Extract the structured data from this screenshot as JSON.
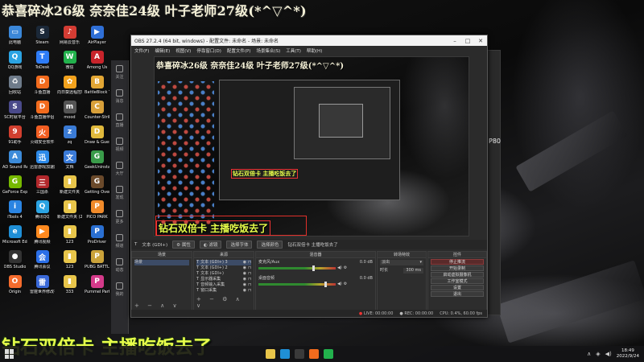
{
  "overlay": {
    "top_banner": "恭喜碎冰26级 奈奈佳24级 叶子老师27级(*^▽^*)",
    "bottom_banner": "钻石双倍卡 主播吃饭去了"
  },
  "desktop_icons": [
    {
      "label": "此电脑",
      "color": "#3b87d8",
      "glyph": "▭"
    },
    {
      "label": "Steam",
      "color": "#1b2838",
      "glyph": "S"
    },
    {
      "label": "网易云音乐",
      "color": "#d43c33",
      "glyph": "♪"
    },
    {
      "label": "AirPlayer",
      "color": "#2f6fd6",
      "glyph": "▶"
    },
    {
      "label": "QQ游戏",
      "color": "#2ba3e2",
      "glyph": "Q"
    },
    {
      "label": "ToDesk",
      "color": "#2e7cf6",
      "glyph": "T"
    },
    {
      "label": "微信",
      "color": "#22b14c",
      "glyph": "W"
    },
    {
      "label": "Among Us",
      "color": "#c8242b",
      "glyph": "A"
    },
    {
      "label": "回收站",
      "color": "#6e7b8a",
      "glyph": "♻"
    },
    {
      "label": "斗鱼直播",
      "color": "#f26b1d",
      "glyph": "D"
    },
    {
      "label": "向日葵远程控制",
      "color": "#f2a21d",
      "glyph": "✿"
    },
    {
      "label": "BattleBlock Theater",
      "color": "#e2a634",
      "glyph": "B"
    },
    {
      "label": "SC时就平台",
      "color": "#4a4a8a",
      "glyph": "S"
    },
    {
      "label": "斗鱼直播伴侣",
      "color": "#f26b1d",
      "glyph": "D"
    },
    {
      "label": "mood",
      "color": "#555555",
      "glyph": "m"
    },
    {
      "label": "Counter-Strike Global Off...",
      "color": "#d8a03a",
      "glyph": "C"
    },
    {
      "label": "91助手",
      "color": "#d13f2f",
      "glyph": "9"
    },
    {
      "label": "火绒安全软件",
      "color": "#f25e22",
      "glyph": "火"
    },
    {
      "label": "zq",
      "color": "#3a7bd5",
      "glyph": "z"
    },
    {
      "label": "Draw & Guess",
      "color": "#e0b93c",
      "glyph": "D"
    },
    {
      "label": "AD Sound Recorder",
      "color": "#3c8bd9",
      "glyph": "A"
    },
    {
      "label": "迅雷游戏加速器",
      "color": "#2d8ae8",
      "glyph": "迅"
    },
    {
      "label": "文档",
      "color": "#3b7bd8",
      "glyph": "文"
    },
    {
      "label": "GeekUninstaller",
      "color": "#3a9c4a",
      "glyph": "G"
    },
    {
      "label": "GeForce Experience",
      "color": "#76b900",
      "glyph": "G"
    },
    {
      "label": "三国杀",
      "color": "#b2282c",
      "glyph": "三"
    },
    {
      "label": "新建文件夹",
      "color": "#e8c54a",
      "glyph": "▮"
    },
    {
      "label": "Getting Over It",
      "color": "#6b4a2b",
      "glyph": "G"
    },
    {
      "label": "iTools 4",
      "color": "#2a84e2",
      "glyph": "i"
    },
    {
      "label": "腾讯QQ",
      "color": "#2ba3e2",
      "glyph": "Q"
    },
    {
      "label": "新建文件夹 (2)",
      "color": "#e8c54a",
      "glyph": "▮"
    },
    {
      "label": "PICO PARK",
      "color": "#f08a2a",
      "glyph": "P"
    },
    {
      "label": "Microsoft Edge",
      "color": "#1f8fd6",
      "glyph": "e"
    },
    {
      "label": "腾讯视频",
      "color": "#ff8a1f",
      "glyph": "▶"
    },
    {
      "label": "123",
      "color": "#e8c54a",
      "glyph": "▮"
    },
    {
      "label": "ProDriver",
      "color": "#2a6fd1",
      "glyph": "P"
    },
    {
      "label": "OBS Studio",
      "color": "#333333",
      "glyph": "●"
    },
    {
      "label": "腾讯会议",
      "color": "#2b6fe8",
      "glyph": "会"
    },
    {
      "label": "123",
      "color": "#e8c54a",
      "glyph": "▮"
    },
    {
      "label": "PUBG BATTLEGR...",
      "color": "#caa23a",
      "glyph": "P"
    },
    {
      "label": "Origin",
      "color": "#f56c2d",
      "glyph": "O"
    },
    {
      "label": "雷霆世界修改平台",
      "color": "#3a69d8",
      "glyph": "雷"
    },
    {
      "label": "333",
      "color": "#e8c54a",
      "glyph": "▮"
    },
    {
      "label": "Pummel Party",
      "color": "#d43a8a",
      "glyph": "P"
    }
  ],
  "side_panel": {
    "items": [
      "关注",
      "消息",
      "直播",
      "视频",
      "大厅",
      "发现",
      "更多",
      "频道",
      "动态",
      "我的"
    ]
  },
  "back_window": {
    "text": "P80"
  },
  "obs": {
    "title": "OBS 27.2.4 (64 bit, windows) - 配置文件: 未命名 - 场景: 未命名",
    "menu": [
      "文件(F)",
      "编辑(E)",
      "视图(V)",
      "停靠窗口(D)",
      "配置文件(P)",
      "场景集合(S)",
      "工具(T)",
      "帮助(H)"
    ],
    "preview": {
      "top_text": "恭喜碎冰26级 奈奈佳24级 叶子老师27级(*^▽^*)",
      "bottom_text": "钻石双倍卡 主播吃饭去了",
      "inner_text": "钻石双倍卡 主播吃饭去了"
    },
    "source_toolbar": {
      "source_name": "文本 (GDI+)",
      "properties": "属性",
      "filters": "滤镜",
      "select_font": "选择字体",
      "select_color": "选择颜色",
      "text_value": "钻石双倍卡 主播吃饭去了"
    },
    "docks": {
      "scenes_title": "场景",
      "scenes": [
        "场景"
      ],
      "sources_title": "来源",
      "sources": [
        "文本 (GDI+) 3",
        "文本 (GDI+) 2",
        "文本 (GDI+)",
        "显示器采集",
        "音频输入采集",
        "窗口采集"
      ],
      "mixer_title": "混音器",
      "mixer": [
        {
          "name": "麦克风/Aux",
          "db": "0.0 dB",
          "level": 0.72
        },
        {
          "name": "桌面音频",
          "db": "0.0 dB",
          "level": 0.88
        }
      ],
      "transitions_title": "转场特效",
      "transition_type": "淡出",
      "duration_label": "时长",
      "duration_value": "300 ms",
      "controls_title": "控件",
      "controls": [
        "停止推流",
        "开始录制",
        "启动虚拟摄像机",
        "工作室模式",
        "设置",
        "退出"
      ]
    },
    "status": {
      "live": "LIVE: 00:00:00",
      "rec": "REC: 00:00:00",
      "cpu": "CPU: 0.4%, 60.00 fps"
    }
  },
  "taskbar": {
    "apps": [
      {
        "name": "file-explorer",
        "color": "#e8c54a"
      },
      {
        "name": "edge",
        "color": "#1f8fd6"
      },
      {
        "name": "obs",
        "color": "#3a3a3a"
      },
      {
        "name": "douyu",
        "color": "#f26b1d"
      },
      {
        "name": "wechat",
        "color": "#22b14c"
      }
    ],
    "time": "18:49",
    "date": "2022/9/24"
  }
}
